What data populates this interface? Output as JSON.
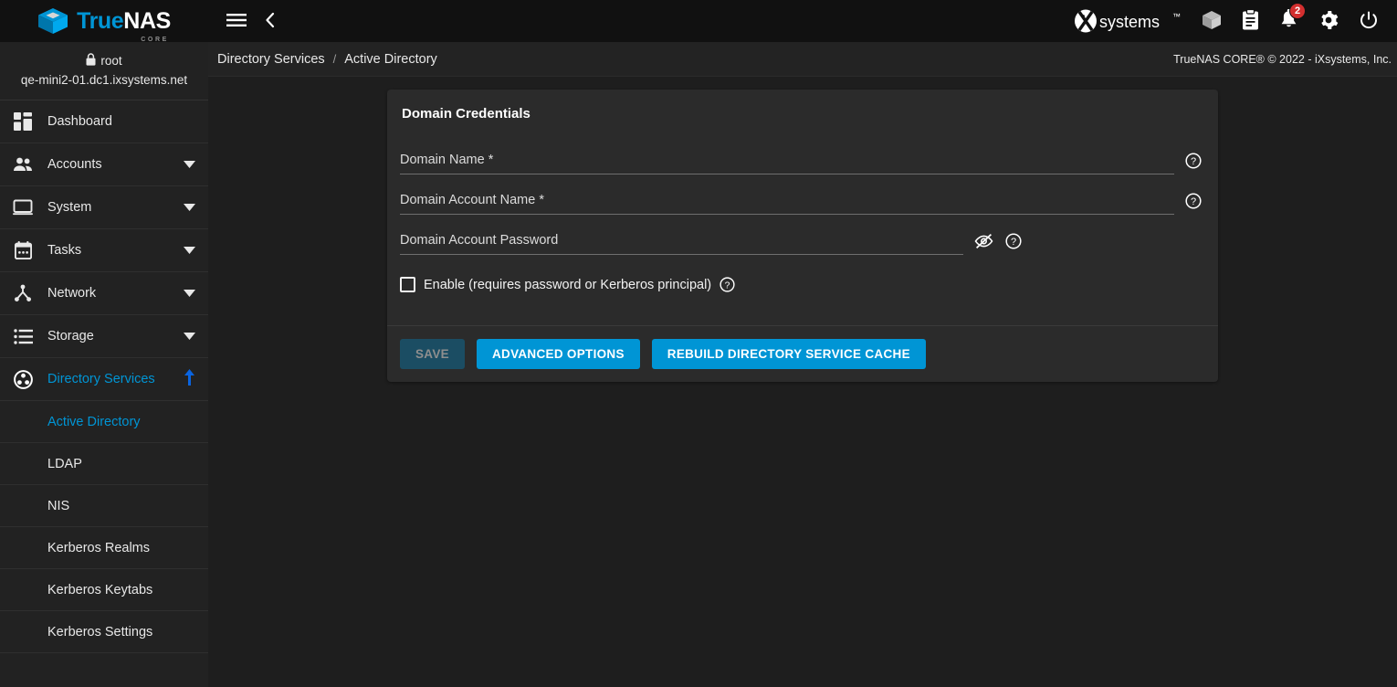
{
  "app": {
    "brand_true": "True",
    "brand_nas": "NAS",
    "brand_edition": "CORE",
    "accent_color": "#0095d5",
    "badge_color": "#d32f2f"
  },
  "topbar": {
    "menu_icon": "hamburger-menu-icon",
    "back_icon": "chevron-left-icon",
    "vendor_logo": "ixsystems-logo",
    "vendor_name": "iXsystems",
    "icons": [
      {
        "name": "jobs-cube-icon",
        "label": "Jobs"
      },
      {
        "name": "task-manager-clipboard-icon",
        "label": "Task Manager"
      },
      {
        "name": "notifications-bell-icon",
        "label": "Alerts",
        "badge": "2"
      },
      {
        "name": "settings-gear-icon",
        "label": "Settings"
      },
      {
        "name": "power-icon",
        "label": "Power"
      }
    ]
  },
  "sidebar": {
    "user": {
      "lock_icon": "lock-icon",
      "username": "root",
      "hostname": "qe-mini2-01.dc1.ixsystems.net"
    },
    "items": [
      {
        "label": "Dashboard",
        "icon": "dashboard-grid-icon",
        "expandable": false,
        "active": false
      },
      {
        "label": "Accounts",
        "icon": "accounts-people-icon",
        "expandable": true,
        "active": false
      },
      {
        "label": "System",
        "icon": "system-monitor-icon",
        "expandable": true,
        "active": false
      },
      {
        "label": "Tasks",
        "icon": "tasks-calendar-icon",
        "expandable": true,
        "active": false
      },
      {
        "label": "Network",
        "icon": "network-topology-icon",
        "expandable": true,
        "active": false
      },
      {
        "label": "Storage",
        "icon": "storage-list-icon",
        "expandable": true,
        "active": false
      },
      {
        "label": "Directory Services",
        "icon": "directory-services-icon",
        "expandable": true,
        "active": true
      }
    ],
    "subitems": [
      {
        "label": "Active Directory",
        "active": true
      },
      {
        "label": "LDAP",
        "active": false
      },
      {
        "label": "NIS",
        "active": false
      },
      {
        "label": "Kerberos Realms",
        "active": false
      },
      {
        "label": "Kerberos Keytabs",
        "active": false
      },
      {
        "label": "Kerberos Settings",
        "active": false
      }
    ]
  },
  "breadcrumb": {
    "parent": "Directory Services",
    "separator": "/",
    "current": "Active Directory",
    "copyright": "TrueNAS CORE® © 2022 - iXsystems, Inc."
  },
  "form": {
    "title": "Domain Credentials",
    "fields": [
      {
        "label": "Domain Name *",
        "value": "",
        "type": "text",
        "help_icon": "help-circle-icon"
      },
      {
        "label": "Domain Account Name *",
        "value": "",
        "type": "text",
        "help_icon": "help-circle-icon"
      },
      {
        "label": "Domain Account Password",
        "value": "",
        "type": "password",
        "reveal_icon": "eye-off-icon",
        "help_icon": "help-circle-icon"
      }
    ],
    "checkbox": {
      "label": "Enable (requires password or Kerberos principal)",
      "checked": false,
      "help_icon": "help-circle-icon"
    },
    "buttons": [
      {
        "label": "SAVE",
        "style": "disabled"
      },
      {
        "label": "ADVANCED OPTIONS",
        "style": "primary"
      },
      {
        "label": "REBUILD DIRECTORY SERVICE CACHE",
        "style": "primary"
      }
    ]
  }
}
